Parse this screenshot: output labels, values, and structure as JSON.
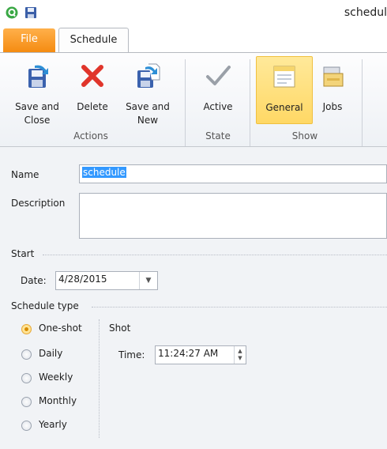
{
  "title_bar": {
    "title": "schedul"
  },
  "tabs": {
    "file": "File",
    "schedule": "Schedule"
  },
  "ribbon": {
    "groups": {
      "actions": {
        "label": "Actions",
        "save_close": "Save and Close",
        "delete": "Delete",
        "save_new": "Save and New"
      },
      "state": {
        "label": "State",
        "active": "Active"
      },
      "show": {
        "label": "Show",
        "general": "General",
        "jobs": "Jobs",
        "selected": "General"
      }
    }
  },
  "form": {
    "name": {
      "label": "Name",
      "value": "schedule"
    },
    "description": {
      "label": "Description",
      "value": ""
    },
    "start": {
      "section": "Start",
      "date_label": "Date:",
      "date_value": "4/28/2015"
    },
    "schedule_type": {
      "section": "Schedule type",
      "options": [
        "One-shot",
        "Daily",
        "Weekly",
        "Monthly",
        "Yearly"
      ],
      "selected": "One-shot"
    },
    "shot": {
      "heading": "Shot",
      "time_label": "Time:",
      "time_value": "11:24:27 AM"
    }
  },
  "colors": {
    "file_tab": "#f48a10",
    "selected_button": "#ffd865",
    "selection": "#3399ff"
  }
}
